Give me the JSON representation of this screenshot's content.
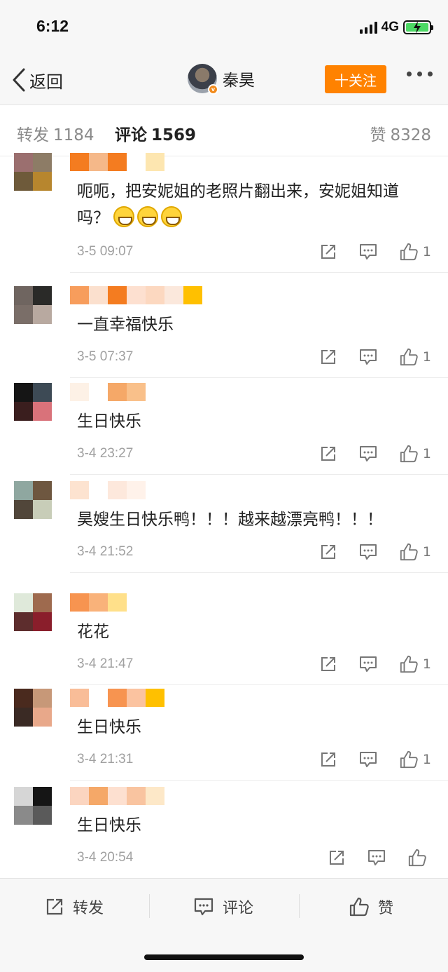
{
  "status_bar": {
    "time": "6:12",
    "network": "4G"
  },
  "nav": {
    "back_label": "返回",
    "user_name": "秦昊",
    "follow_label": "十关注"
  },
  "tabs": {
    "repost": {
      "label": "转发",
      "count": "1184"
    },
    "comment": {
      "label": "评论",
      "count": "1569"
    },
    "like": {
      "label": "赞",
      "count": "8328"
    }
  },
  "comments": [
    {
      "text": "呃呃，把安妮姐的老照片翻出来，安妮姐知道吗？",
      "emoji_count": 3,
      "time": "3-5 09:07",
      "likes": "1",
      "avatar_colors": [
        "#9b6f6f",
        "#8d7c66",
        "#6e5a3a",
        "#b7862e"
      ],
      "name_colors": [
        "#f47c20",
        "#f5b889",
        "#f47c20",
        "#ffffff",
        "#fde6b0"
      ]
    },
    {
      "text": "一直幸福快乐",
      "time": "3-5 07:37",
      "likes": "1",
      "avatar_colors": [
        "#6f6560",
        "#2a2a28",
        "#7a6e68",
        "#b8a9a0"
      ],
      "name_colors": [
        "#f79d5c",
        "#fbe0ce",
        "#f47c20",
        "#fde0d0",
        "#fcd8c0",
        "#fbe8dc",
        "#ffc000"
      ]
    },
    {
      "text": "生日快乐",
      "time": "3-4 23:27",
      "likes": "1",
      "avatar_colors": [
        "#151515",
        "#3d4a55",
        "#3a1e1e",
        "#d9727a"
      ],
      "name_colors": [
        "#fdf1e6",
        "#ffffff",
        "#f5a868",
        "#f9c08a"
      ]
    },
    {
      "text": "昊嫂生日快乐鸭！！！越来越漂亮鸭！！！",
      "time": "3-4 21:52",
      "likes": "1",
      "avatar_colors": [
        "#8fa7a0",
        "#6e5740",
        "#51463a",
        "#c8cdb8"
      ],
      "name_colors": [
        "#fde3d0",
        "#ffffff",
        "#fde8dc",
        "#fff2ea"
      ]
    },
    {
      "text": "花花",
      "time": "3-4 21:47",
      "likes": "1",
      "avatar_colors": [
        "#dfe9da",
        "#9e6a4e",
        "#5d2d2d",
        "#8a1e2b"
      ],
      "name_colors": [
        "#f79450",
        "#f9b27a",
        "#ffe08a"
      ]
    },
    {
      "text": "生日快乐",
      "time": "3-4 21:31",
      "likes": "1",
      "avatar_colors": [
        "#4a2a1e",
        "#c79878",
        "#3a2a24",
        "#e8a88a"
      ],
      "name_colors": [
        "#f9bd98",
        "#ffffff",
        "#f79450",
        "#fbc3a0",
        "#ffc000"
      ]
    },
    {
      "text": "生日快乐",
      "time": "3-4 20:54",
      "likes": "",
      "avatar_colors": [
        "#d6d6d6",
        "#151515",
        "#8a8a8a",
        "#5a5a5a"
      ],
      "name_colors": [
        "#fbd5c0",
        "#f5a868",
        "#fde0d0",
        "#f9c4a0",
        "#fde8c8"
      ]
    }
  ],
  "bottom_bar": {
    "repost_label": "转发",
    "comment_label": "评论",
    "like_label": "赞"
  },
  "colors": {
    "accent": "#ff8200",
    "time_gray": "#a0a0a0"
  },
  "icons": [
    "chevron-left-icon",
    "signal-icon",
    "battery-icon",
    "more-icon",
    "share-icon",
    "comment-icon",
    "thumbs-up-icon"
  ]
}
